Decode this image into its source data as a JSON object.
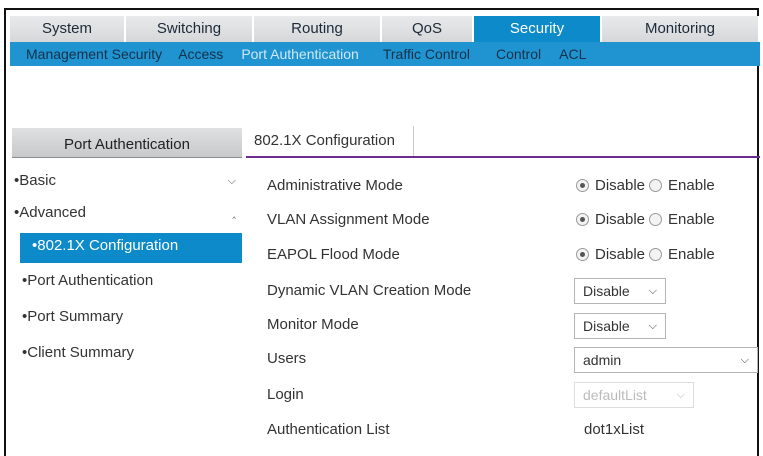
{
  "topnav": [
    {
      "label": "System",
      "active": false
    },
    {
      "label": "Switching",
      "active": false
    },
    {
      "label": "Routing",
      "active": false
    },
    {
      "label": "QoS",
      "active": false
    },
    {
      "label": "Security",
      "active": true
    },
    {
      "label": "Monitoring",
      "active": false
    }
  ],
  "subnav": [
    {
      "label": "Management Security",
      "active": false
    },
    {
      "label": "Access",
      "active": false
    },
    {
      "label": "Port Authentication",
      "active": true
    },
    {
      "label": "Traffic Control",
      "active": false
    },
    {
      "label": "Control",
      "active": false
    },
    {
      "label": "ACL",
      "active": false
    }
  ],
  "sidebar": {
    "title": "Port Authentication",
    "sections": [
      {
        "label": "Basic",
        "chevron": "chevron-down-icon"
      },
      {
        "label": "Advanced",
        "chevron": "chevron-up-icon"
      }
    ],
    "items": [
      {
        "label": "802.1X Configuration",
        "active": true
      },
      {
        "label": "Port Authentication",
        "active": false
      },
      {
        "label": "Port Summary",
        "active": false
      },
      {
        "label": "Client Summary",
        "active": false
      }
    ]
  },
  "panel": {
    "title": "802.1X Configuration",
    "fields": {
      "admin_mode": {
        "label": "Administrative Mode",
        "opt1": "Disable",
        "opt2": "Enable",
        "selected": "Disable"
      },
      "vlan_assign": {
        "label": "VLAN Assignment Mode",
        "opt1": "Disable",
        "opt2": "Enable",
        "selected": "Disable"
      },
      "eapol_flood": {
        "label": "EAPOL Flood Mode",
        "opt1": "Disable",
        "opt2": "Enable",
        "selected": "Disable"
      },
      "dyn_vlan": {
        "label": "Dynamic VLAN Creation Mode",
        "value": "Disable"
      },
      "monitor": {
        "label": "Monitor Mode",
        "value": "Disable"
      },
      "users": {
        "label": "Users",
        "value": "admin"
      },
      "login": {
        "label": "Login",
        "value": "defaultList"
      },
      "auth_list": {
        "label": "Authentication List",
        "value": "dot1xList"
      }
    }
  },
  "colors": {
    "accent": "#0c8ac9",
    "subnav": "#1f94d0",
    "panel_rule": "#6a2c8e"
  }
}
